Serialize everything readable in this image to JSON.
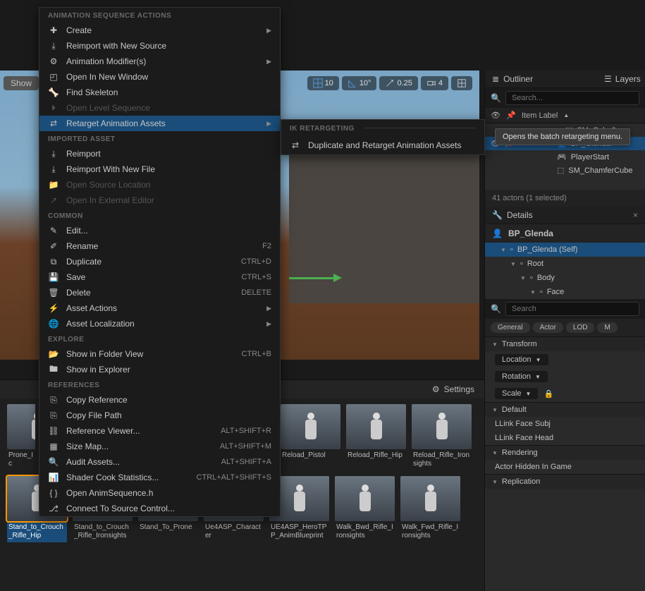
{
  "viewport": {
    "show_label": "Show",
    "grid_snap": "10",
    "angle_snap": "10°",
    "scale_snap": "0.25",
    "camera_speed": "4"
  },
  "context_menu": {
    "sections": {
      "animation_actions": "ANIMATION SEQUENCE ACTIONS",
      "imported_asset": "IMPORTED ASSET",
      "common": "COMMON",
      "explore": "EXPLORE",
      "references": "REFERENCES"
    },
    "items": {
      "create": "Create",
      "reimport_new_source": "Reimport with New Source",
      "animation_modifiers": "Animation Modifier(s)",
      "open_new_window": "Open In New Window",
      "find_skeleton": "Find Skeleton",
      "open_level_sequence": "Open Level Sequence",
      "retarget_animation": "Retarget Animation Assets",
      "reimport": "Reimport",
      "reimport_with_file": "Reimport With New File",
      "open_source_location": "Open Source Location",
      "open_external_editor": "Open In External Editor",
      "edit": "Edit...",
      "rename": "Rename",
      "duplicate": "Duplicate",
      "save": "Save",
      "delete": "Delete",
      "asset_actions": "Asset Actions",
      "asset_localization": "Asset Localization",
      "show_folder_view": "Show in Folder View",
      "show_explorer": "Show in Explorer",
      "copy_reference": "Copy Reference",
      "copy_file_path": "Copy File Path",
      "reference_viewer": "Reference Viewer...",
      "size_map": "Size Map...",
      "audit_assets": "Audit Assets...",
      "shader_cook_stats": "Shader Cook Statistics...",
      "open_animsequence": "Open AnimSequence.h",
      "connect_source_control": "Connect To Source Control..."
    },
    "shortcuts": {
      "rename": "F2",
      "duplicate": "CTRL+D",
      "save": "CTRL+S",
      "delete": "DELETE",
      "show_folder_view": "CTRL+B",
      "reference_viewer": "ALT+SHIFT+R",
      "size_map": "ALT+SHIFT+M",
      "audit_assets": "ALT+SHIFT+A",
      "shader_cook_stats": "CTRL+ALT+SHIFT+S"
    }
  },
  "submenu": {
    "header": "IK RETARGETING",
    "duplicate_retarget": "Duplicate and Retarget Animation Assets"
  },
  "tooltip": "Opens the batch retargeting menu.",
  "outliner": {
    "title": "Outliner",
    "layers_tab": "Layers",
    "search_placeholder": "Search...",
    "column_label": "Item Label",
    "items": [
      {
        "name": "SM_Cube6",
        "indent": 60,
        "icon": "mesh"
      },
      {
        "name": "BP_Glenda",
        "indent": 48,
        "icon": "bp",
        "selected": true,
        "visible": true
      },
      {
        "name": "PlayerStart",
        "indent": 48,
        "icon": "player"
      },
      {
        "name": "SM_ChamferCube",
        "indent": 48,
        "icon": "mesh"
      }
    ],
    "actor_count": "41 actors (1 selected)"
  },
  "details": {
    "title": "Details",
    "actor_name": "BP_Glenda",
    "components": [
      {
        "name": "BP_Glenda (Self)",
        "indent": 0,
        "selected": true
      },
      {
        "name": "Root",
        "indent": 14
      },
      {
        "name": "Body",
        "indent": 28
      },
      {
        "name": "Face",
        "indent": 42
      }
    ],
    "search_placeholder": "Search",
    "filters": [
      "General",
      "Actor",
      "LOD",
      "M"
    ],
    "sections": {
      "transform": {
        "title": "Transform",
        "location": "Location",
        "rotation": "Rotation",
        "scale": "Scale"
      },
      "default": {
        "title": "Default",
        "llink_face_subj": "LLink Face Subj",
        "llink_face_head": "LLink Face Head"
      },
      "rendering": {
        "title": "Rendering",
        "actor_hidden": "Actor Hidden In Game"
      },
      "replication": {
        "title": "Replication"
      }
    }
  },
  "content_browser": {
    "settings_label": "Settings",
    "assets": [
      {
        "label": "Prone_Ic",
        "partial": true
      },
      {
        "label": "Reload_Pistol",
        "partial_left": true
      },
      {
        "label": "Reload_Rifle_Hip"
      },
      {
        "label": "Reload_Rifle_Ironsights"
      },
      {
        "label": "Stand_to_Crouch_Rifle_Hip",
        "selected": true
      },
      {
        "label": "Stand_to_Crouch_Rifle_Ironsights"
      },
      {
        "label": "Stand_To_Prone"
      },
      {
        "label": "Ue4ASP_Character"
      },
      {
        "label": "UE4ASP_HeroTPP_AnimBlueprint"
      },
      {
        "label": "Walk_Bwd_Rifle_Ironsights"
      },
      {
        "label": "Walk_Fwd_Rifle_Ironsights"
      }
    ]
  }
}
